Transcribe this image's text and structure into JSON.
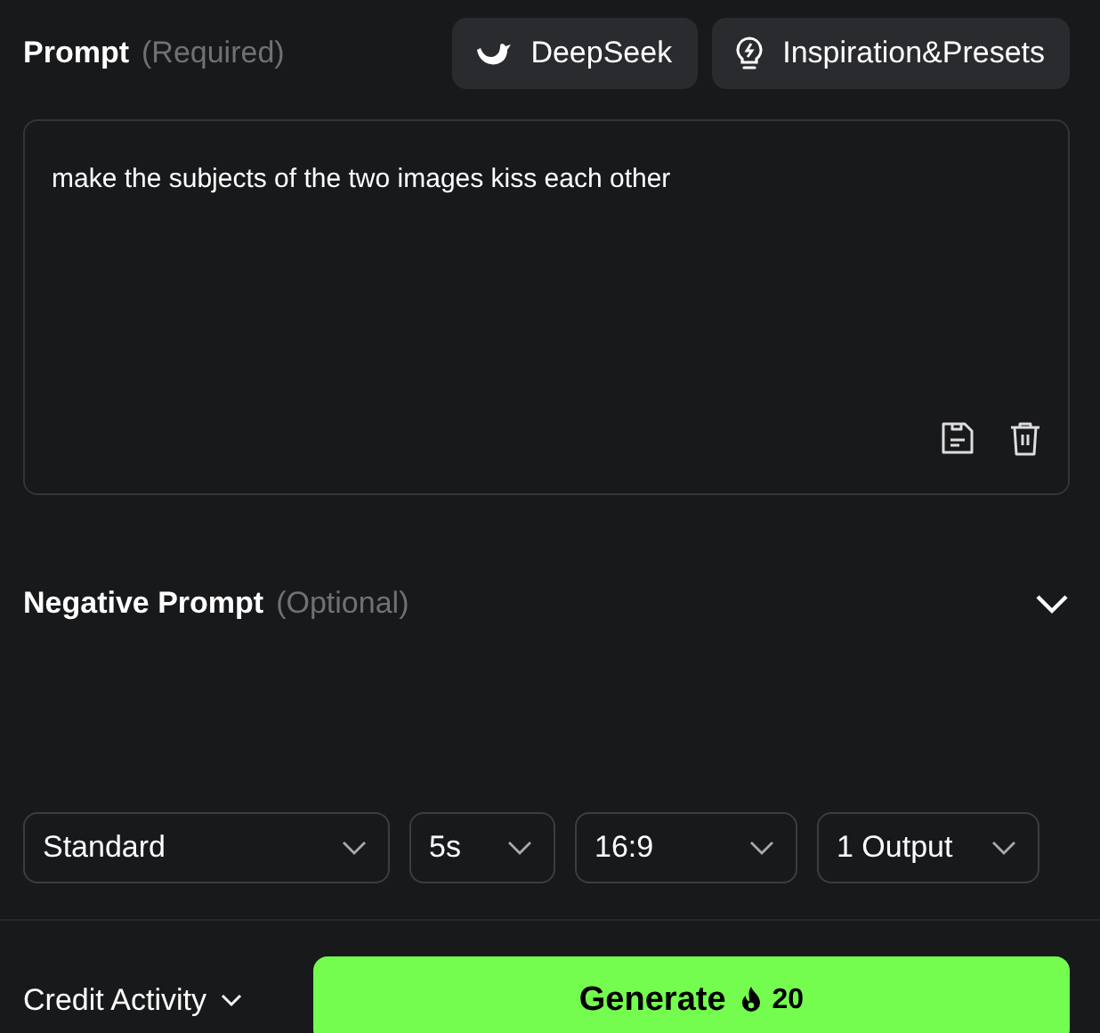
{
  "prompt": {
    "label": "Prompt",
    "hint": "(Required)",
    "value": "make the subjects of the two images kiss each other"
  },
  "header_buttons": [
    {
      "kind": "deepseek",
      "label": "DeepSeek"
    },
    {
      "kind": "inspiration",
      "label": "Inspiration&Presets"
    }
  ],
  "negative_prompt": {
    "label": "Negative Prompt",
    "hint": "(Optional)",
    "expanded": false
  },
  "selects": [
    {
      "value": "Standard"
    },
    {
      "value": "5s"
    },
    {
      "value": "16:9"
    },
    {
      "value": "1 Output"
    }
  ],
  "credit_activity": "Credit Activity",
  "generate": {
    "label": "Generate",
    "cost": "20"
  }
}
